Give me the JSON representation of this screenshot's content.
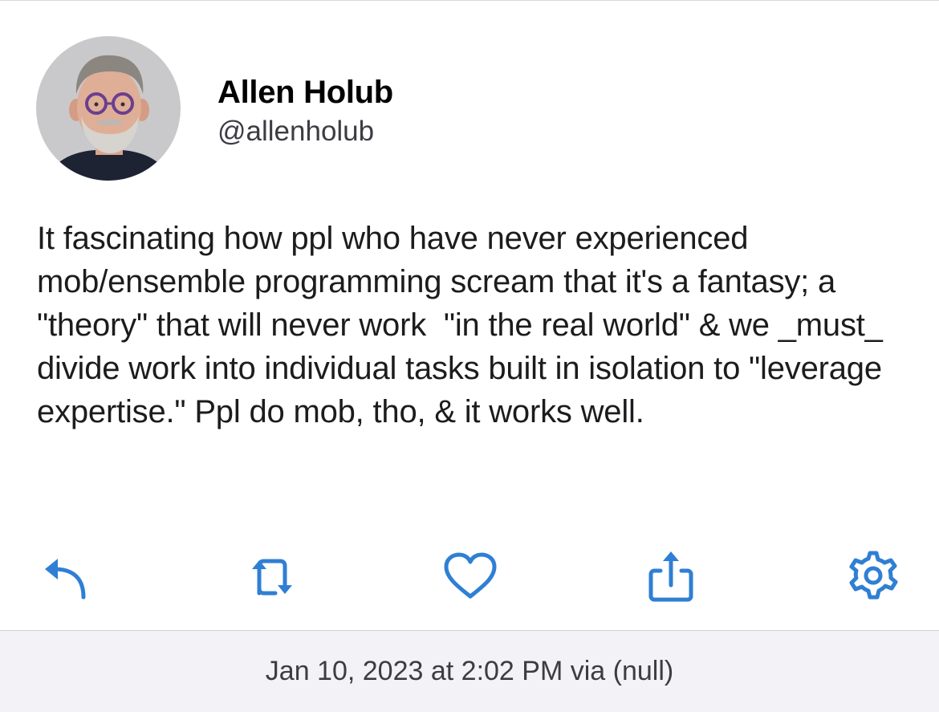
{
  "tweet": {
    "author": {
      "display_name": "Allen Holub",
      "handle": "@allenholub"
    },
    "text": "It fascinating how ppl who have never experienced mob/ensemble programming scream that it's a fantasy; a \"theory\" that will never work  \"in the real world\" & we _must_ divide work into individual tasks built in isolation to \"leverage expertise.\" Ppl do mob, tho, & it works well."
  },
  "actions": [
    {
      "name": "reply",
      "icon": "reply-icon"
    },
    {
      "name": "retweet",
      "icon": "retweet-icon"
    },
    {
      "name": "like",
      "icon": "heart-icon"
    },
    {
      "name": "share",
      "icon": "share-icon"
    },
    {
      "name": "settings",
      "icon": "gear-icon"
    }
  ],
  "footer": {
    "timestamp": "Jan 10, 2023 at 2:02 PM via (null)"
  },
  "colors": {
    "accent": "#2f7fd4",
    "footer_bg": "#f2f2f7",
    "text": "#1c1c1e",
    "secondary_text": "#3c3c43"
  }
}
